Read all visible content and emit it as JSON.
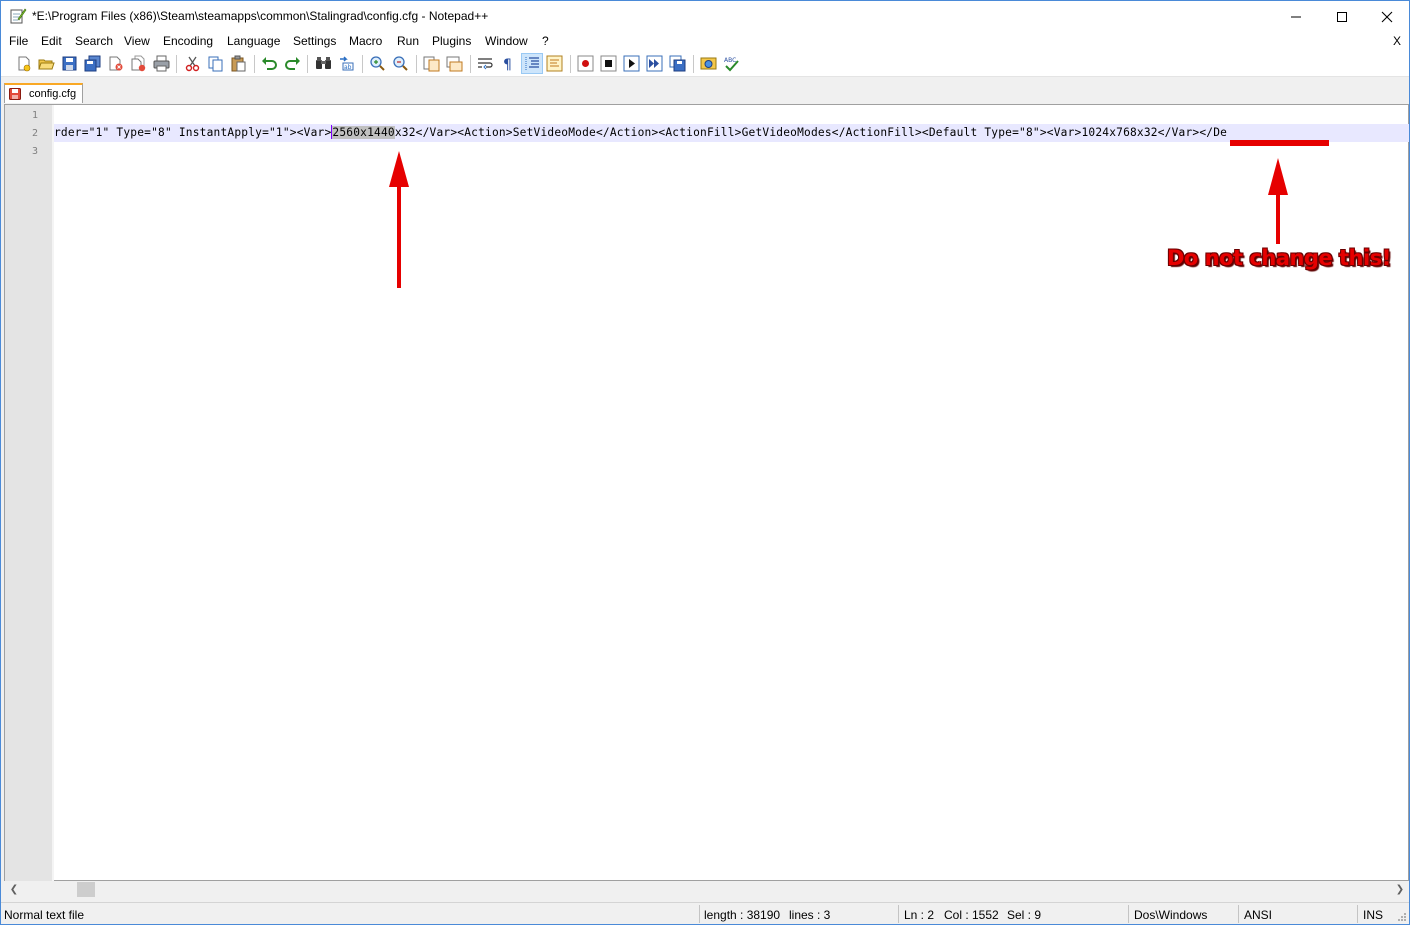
{
  "window": {
    "title": "*E:\\Program Files (x86)\\Steam\\steamapps\\common\\Stalingrad\\config.cfg - Notepad++",
    "minimize_icon": "minimize-icon",
    "maximize_icon": "maximize-icon",
    "close_icon": "close-icon"
  },
  "menu": {
    "items": [
      "File",
      "Edit",
      "Search",
      "View",
      "Encoding",
      "Language",
      "Settings",
      "Macro",
      "Run",
      "Plugins",
      "Window",
      "?"
    ],
    "close_doc": "X"
  },
  "toolbar": {
    "buttons": [
      "new-file-icon",
      "open-file-icon",
      "save-icon",
      "save-all-icon",
      "close-icon",
      "close-all-icon",
      "print-icon",
      "cut-icon",
      "copy-icon",
      "paste-icon",
      "undo-icon",
      "redo-icon",
      "find-icon",
      "replace-icon",
      "zoom-in-icon",
      "zoom-out-icon",
      "sync-vertical-icon",
      "sync-horizontal-icon",
      "word-wrap-icon",
      "show-all-chars-icon",
      "indent-guide-icon",
      "doc-map-icon",
      "record-macro-icon",
      "stop-record-icon",
      "playback-icon",
      "run-macro-multiple-icon",
      "save-macro-icon",
      "launch-browser-icon",
      "spellcheck-icon"
    ]
  },
  "tab": {
    "label": "config.cfg",
    "icon": "unsaved-file-icon"
  },
  "editor": {
    "line_numbers": [
      "1",
      "2",
      "3"
    ],
    "line2_before": "rder=\"1\" Type=\"8\" InstantApply=\"1\"><Var>",
    "line2_selected": "2560x1440",
    "line2_after": "x32</Var><Action>SetVideoMode</Action><ActionFill>GetVideoModes</ActionFill><Default Type=\"8\"><Var>1024x768x32</Var></De"
  },
  "annotation": {
    "warning": "Do not change this!",
    "color": "#e60000"
  },
  "status": {
    "file_type": "Normal text file",
    "length": "length : 38190",
    "lines": "lines : 3",
    "ln": "Ln : 2",
    "col": "Col : 1552",
    "sel": "Sel : 9",
    "eol": "Dos\\Windows",
    "encoding": "ANSI",
    "mode": "INS"
  }
}
